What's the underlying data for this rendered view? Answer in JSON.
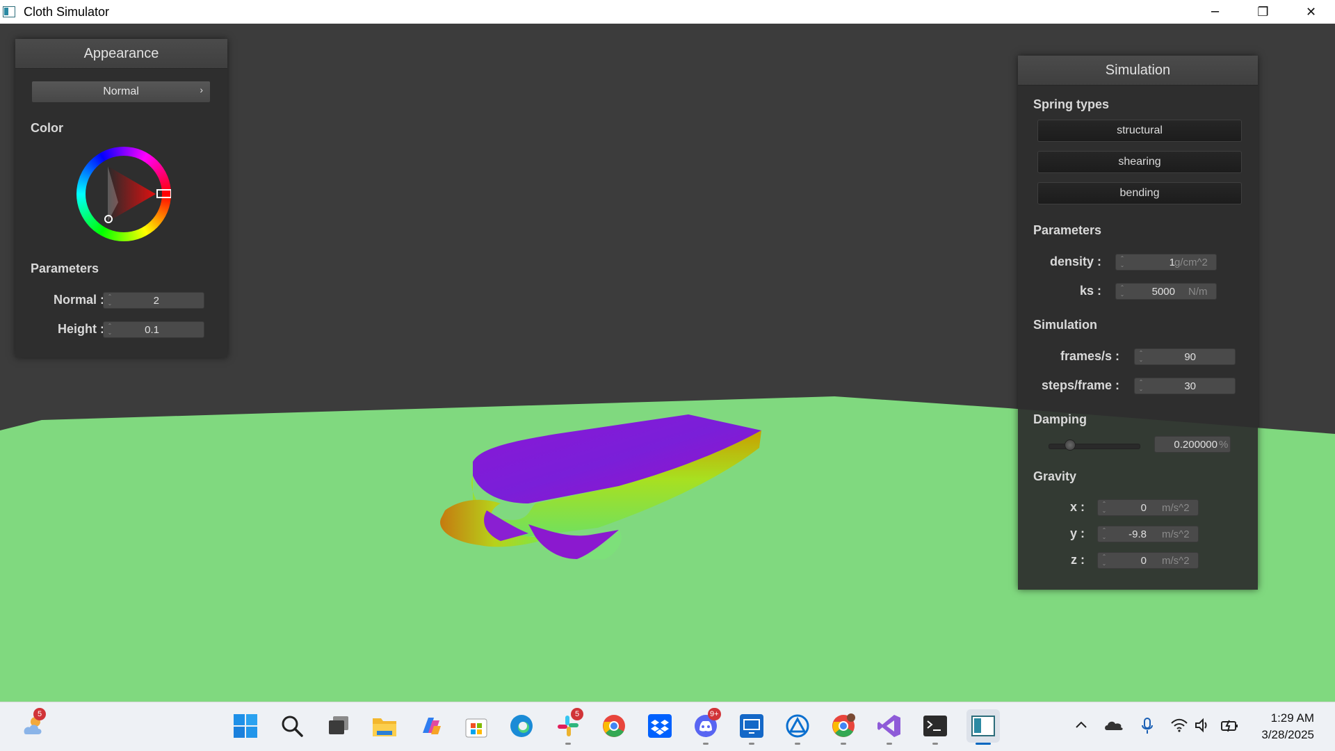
{
  "window": {
    "title": "Cloth Simulator",
    "minimize_glyph": "─",
    "maximize_glyph": "❐",
    "close_glyph": "✕"
  },
  "appearance": {
    "title": "Appearance",
    "mode": "Normal",
    "color_label": "Color",
    "color_hex": "#e01010",
    "parameters_label": "Parameters",
    "normal_label": "Normal :",
    "normal_value": "2",
    "height_label": "Height :",
    "height_value": "0.1"
  },
  "simulation_panel": {
    "title": "Simulation",
    "spring_types_label": "Spring types",
    "springs": [
      "structural",
      "shearing",
      "bending"
    ],
    "parameters_label": "Parameters",
    "density_label": "density :",
    "density_value": "1",
    "density_unit": "g/cm^2",
    "ks_label": "ks :",
    "ks_value": "5000",
    "ks_unit": "N/m",
    "simulation_label": "Simulation",
    "fps_label": "frames/s :",
    "fps_value": "90",
    "steps_label": "steps/frame :",
    "steps_value": "30",
    "damping_label": "Damping",
    "damping_value": "0.200000",
    "damping_unit": "%",
    "damping_level": 0.2,
    "gravity_label": "Gravity",
    "gx_label": "x :",
    "gx_value": "0",
    "gy_label": "y :",
    "gy_value": "-9.8",
    "gz_label": "z :",
    "gz_value": "0",
    "gravity_unit": "m/s^2"
  },
  "scene": {
    "ground_color": "#80d97f",
    "background_color": "#3c3c3c"
  },
  "taskbar": {
    "weather_badge": "5",
    "slack_badge": "5",
    "discord_badge": "9+",
    "apps": [
      "start-icon",
      "search-icon",
      "task-view-icon",
      "file-explorer-icon",
      "copilot-icon",
      "store-icon",
      "edge-icon",
      "slack-icon",
      "chrome-icon",
      "dropbox-icon",
      "discord-icon",
      "remote-desktop-icon",
      "azure-data-studio-icon",
      "chrome-profile-icon",
      "visual-studio-icon",
      "terminal-icon",
      "cloth-simulator-icon"
    ],
    "time": "1:29 AM",
    "date": "3/28/2025"
  }
}
